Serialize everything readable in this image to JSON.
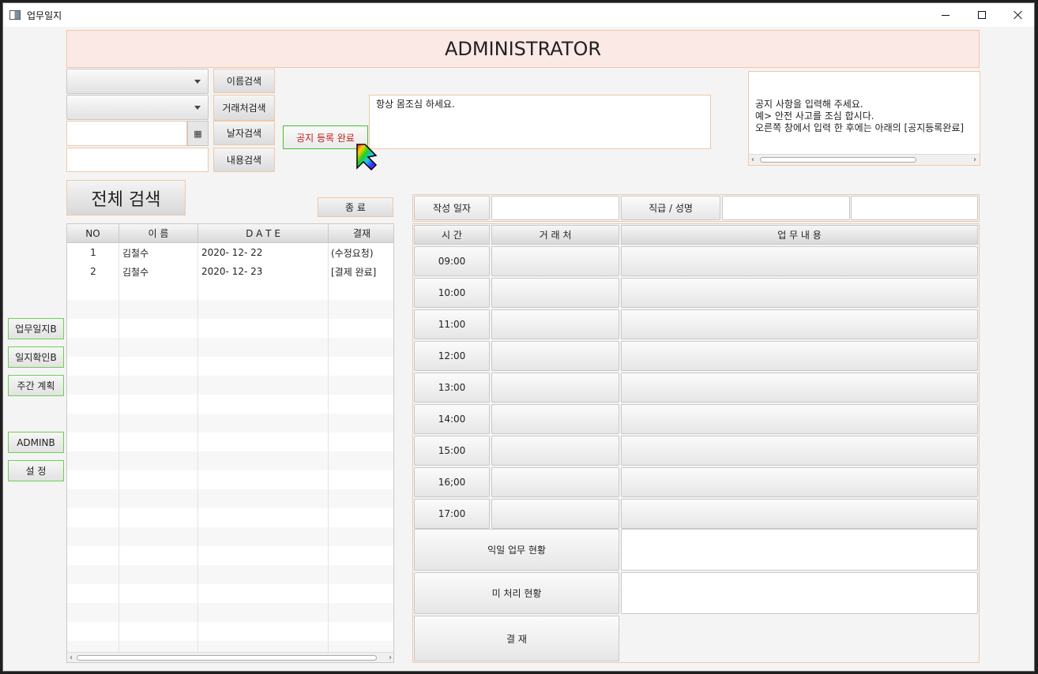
{
  "window": {
    "title": "업무일지"
  },
  "header": {
    "title": "ADMINISTRATOR"
  },
  "search": {
    "name_btn": "이름검색",
    "client_btn": "거래처검색",
    "date_btn": "날자검색",
    "content_btn": "내용검색",
    "all_btn": "전체 검색",
    "calendar_icon": "calendar-icon"
  },
  "notice": {
    "register_btn": "공지 등록 완료",
    "current_text": "항상 몸조심 하세요.",
    "help_text": "공지 사항을 입력해 주세요.\n예> 안전 사고를 조심 합시다.\n오른쪽 창에서 입력 한 후에는 아래의 [공지등록완료]"
  },
  "exit_btn": "종 료",
  "log_table": {
    "headers": [
      "NO",
      "이    름",
      "D A T E",
      "결재"
    ],
    "rows": [
      {
        "no": "1",
        "name": "김철수",
        "date": "2020- 12- 22",
        "status": "(수정요청)"
      },
      {
        "no": "2",
        "name": "김철수",
        "date": "2020- 12- 23",
        "status": "[결제 완료]"
      }
    ]
  },
  "side_nav": {
    "items": [
      "업무일지B",
      "일지확인B",
      "주간 계획",
      "ADMINB",
      "설  정"
    ]
  },
  "detail": {
    "date_label": "작성 일자",
    "rank_label": "직급 / 성명",
    "headers": [
      "시    간",
      "거 래 처",
      "업          무          내          용"
    ],
    "times": [
      "09:00",
      "10:00",
      "11:00",
      "12:00",
      "13:00",
      "14:00",
      "15:00",
      "16;00",
      "17:00"
    ],
    "next_day_label": "익일  업무  현황",
    "pending_label": "미  처리    현황",
    "approve_btn": "결 재"
  }
}
